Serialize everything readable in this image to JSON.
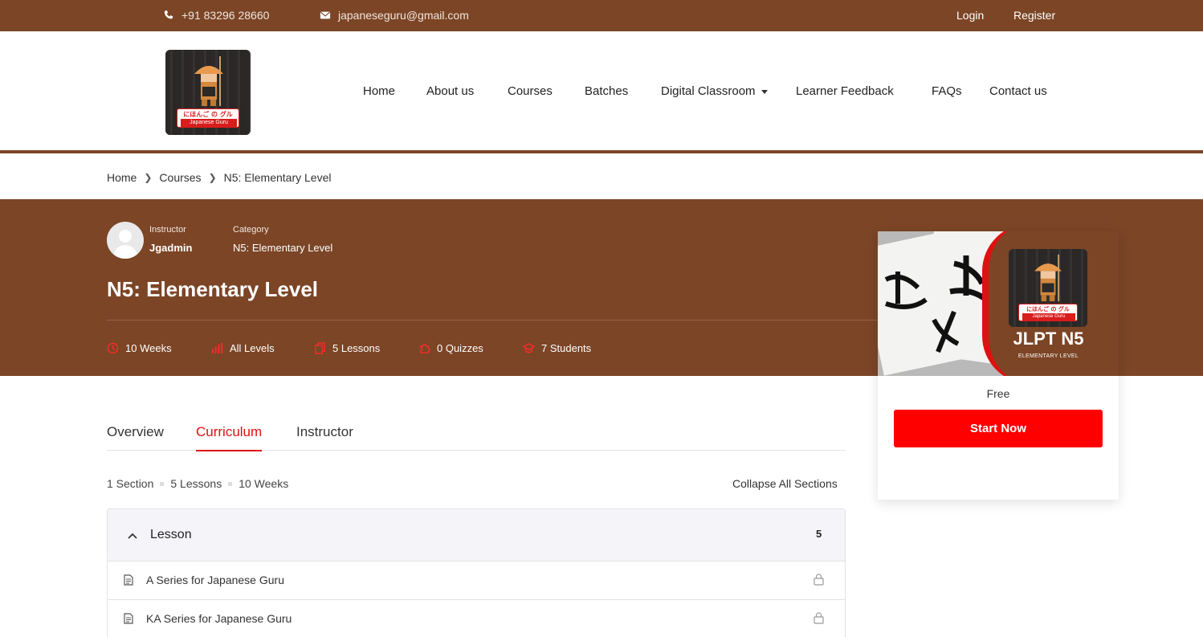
{
  "topbar": {
    "phone": "+91 83296 28660",
    "email": "japaneseguru@gmail.com",
    "login": "Login",
    "register": "Register"
  },
  "logo": {
    "line1": "にほんご の グル",
    "line2": "Japanese Guru"
  },
  "nav": {
    "home": "Home",
    "about": "About us",
    "courses": "Courses",
    "batches": "Batches",
    "digital": "Digital Classroom",
    "feedback": "Learner Feedback",
    "faqs": "FAQs",
    "contact": "Contact us"
  },
  "breadcrumb": {
    "home": "Home",
    "courses": "Courses",
    "current": "N5: Elementary Level"
  },
  "course": {
    "instructor_label": "Instructor",
    "instructor": "Jgadmin",
    "category_label": "Category",
    "category": "N5: Elementary Level",
    "title": "N5: Elementary Level",
    "duration": "10 Weeks",
    "level": "All Levels",
    "lessons": "5 Lessons",
    "quizzes": "0 Quizzes",
    "students": "7 Students"
  },
  "card": {
    "jlpt": "JLPT N5",
    "sub": "ELEMENTARY LEVEL",
    "price": "Free",
    "button": "Start Now"
  },
  "tabs": {
    "overview": "Overview",
    "curriculum": "Curriculum",
    "instructor": "Instructor"
  },
  "curriculum": {
    "sections": "1 Section",
    "lessons": "5 Lessons",
    "weeks": "10 Weeks",
    "collapse": "Collapse All Sections",
    "section_title": "Lesson",
    "section_count": "5",
    "items": [
      {
        "title": "A Series for Japanese Guru"
      },
      {
        "title": "KA Series for Japanese Guru"
      }
    ]
  },
  "colors": {
    "brand_brown": "#7b4526",
    "accent_red": "#ff0000"
  }
}
